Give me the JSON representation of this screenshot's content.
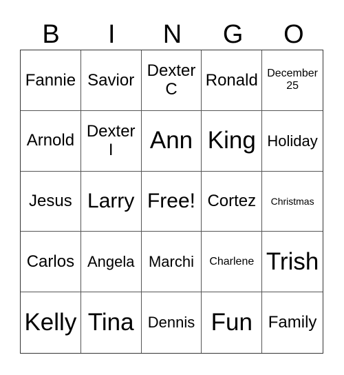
{
  "header": [
    "B",
    "I",
    "N",
    "G",
    "O"
  ],
  "cells": [
    {
      "text": "Fannie",
      "size": "s-m"
    },
    {
      "text": "Savior",
      "size": "s-m"
    },
    {
      "text": "Dexter\nC",
      "size": "s-m"
    },
    {
      "text": "Ronald",
      "size": "s-m"
    },
    {
      "text": "December\n25",
      "size": "s-xs"
    },
    {
      "text": "Arnold",
      "size": "s-m"
    },
    {
      "text": "Dexter\nI",
      "size": "s-m"
    },
    {
      "text": "Ann",
      "size": "s-xl"
    },
    {
      "text": "King",
      "size": "s-xl"
    },
    {
      "text": "Holiday",
      "size": "s-s"
    },
    {
      "text": "Jesus",
      "size": "s-m"
    },
    {
      "text": "Larry",
      "size": "s-l"
    },
    {
      "text": "Free!",
      "size": "s-l"
    },
    {
      "text": "Cortez",
      "size": "s-m"
    },
    {
      "text": "Christmas",
      "size": "s-xxs"
    },
    {
      "text": "Carlos",
      "size": "s-m"
    },
    {
      "text": "Angela",
      "size": "s-s"
    },
    {
      "text": "Marchi",
      "size": "s-s"
    },
    {
      "text": "Charlene",
      "size": "s-xs"
    },
    {
      "text": "Trish",
      "size": "s-xl"
    },
    {
      "text": "Kelly",
      "size": "s-xl"
    },
    {
      "text": "Tina",
      "size": "s-xl"
    },
    {
      "text": "Dennis",
      "size": "s-s"
    },
    {
      "text": "Fun",
      "size": "s-xl"
    },
    {
      "text": "Family",
      "size": "s-m"
    }
  ]
}
